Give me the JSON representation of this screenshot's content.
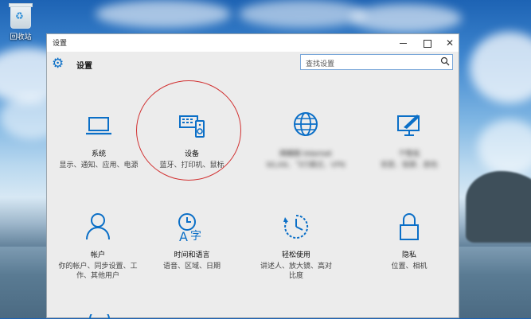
{
  "desktop": {
    "recycle_bin_label": "回收站"
  },
  "window": {
    "title": "设置",
    "controls": {
      "minimize": "minimize",
      "maximize": "maximize",
      "close": "✕"
    }
  },
  "header": {
    "title": "设置",
    "search_placeholder": "查找设置"
  },
  "categories": [
    {
      "name": "系统",
      "desc": "显示、通知、应用、电源",
      "icon": "laptop-icon"
    },
    {
      "name": "设备",
      "desc": "蓝牙、打印机、鼠标",
      "icon": "devices-icon"
    },
    {
      "name": "网络和 Internet",
      "desc": "WLAN、飞行模式、VPN",
      "icon": "globe-icon"
    },
    {
      "name": "个性化",
      "desc": "背景、锁屏、颜色",
      "icon": "personalization-icon"
    },
    {
      "name": "帐户",
      "desc": "你的帐户、同步设置、工作、其他用户",
      "icon": "account-icon"
    },
    {
      "name": "时间和语言",
      "desc": "语音、区域、日期",
      "icon": "time-language-icon"
    },
    {
      "name": "轻松使用",
      "desc": "讲述人、放大镜、高对比度",
      "icon": "ease-of-access-icon"
    },
    {
      "name": "隐私",
      "desc": "位置、相机",
      "icon": "privacy-lock-icon"
    }
  ],
  "colors": {
    "accent": "#0b6fc7",
    "annotation": "#d13030"
  }
}
